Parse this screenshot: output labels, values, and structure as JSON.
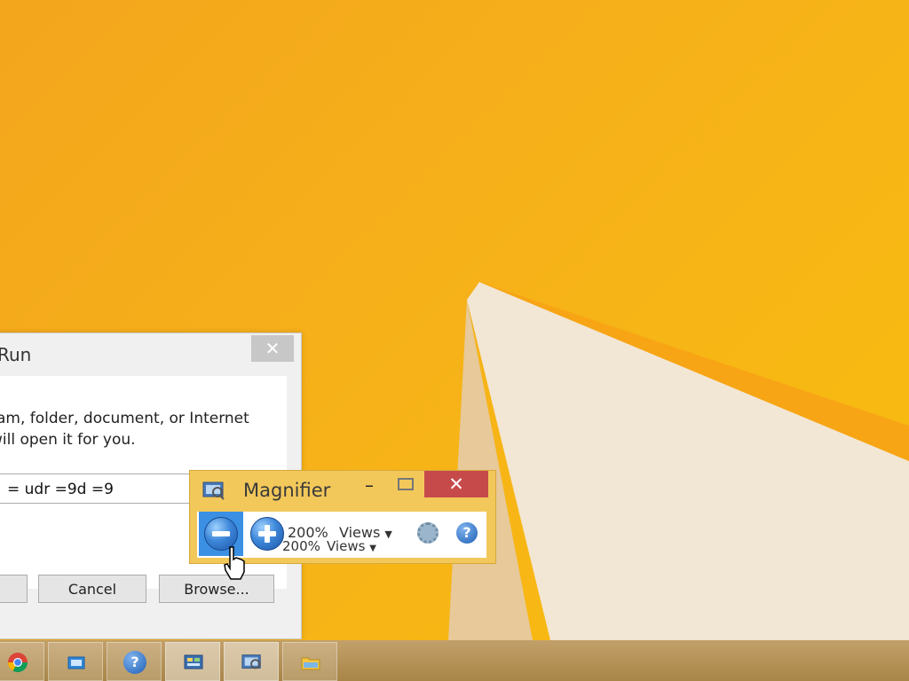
{
  "run_dialog": {
    "title": "Run",
    "close_label": "✕",
    "description_line1": "ram, folder, document, or Internet",
    "description_line2": "will open it for you.",
    "open_value": "= udr =9d =9",
    "ok_label": "",
    "cancel_label": "Cancel",
    "browse_label": "Browse..."
  },
  "magnifier": {
    "title": "Magnifier",
    "minimize_label": "–",
    "close_label": "✕",
    "zoom_percent": "200%",
    "views_label": "Views",
    "ghost_zoom_percent": "200%",
    "ghost_views_label": "Views",
    "help_label": "?"
  },
  "taskbar": {
    "items": [
      {
        "name": "chrome",
        "label": ""
      },
      {
        "name": "file-explorer",
        "label": ""
      },
      {
        "name": "help",
        "label": "?"
      },
      {
        "name": "control-panel",
        "label": ""
      },
      {
        "name": "magnifier",
        "label": ""
      },
      {
        "name": "explorer",
        "label": ""
      }
    ]
  },
  "colors": {
    "desktop": "#f6b01a",
    "magnifier_frame": "#f2c85a",
    "close_red": "#c74a4a",
    "zoom_out_highlight": "#3b90e3"
  }
}
